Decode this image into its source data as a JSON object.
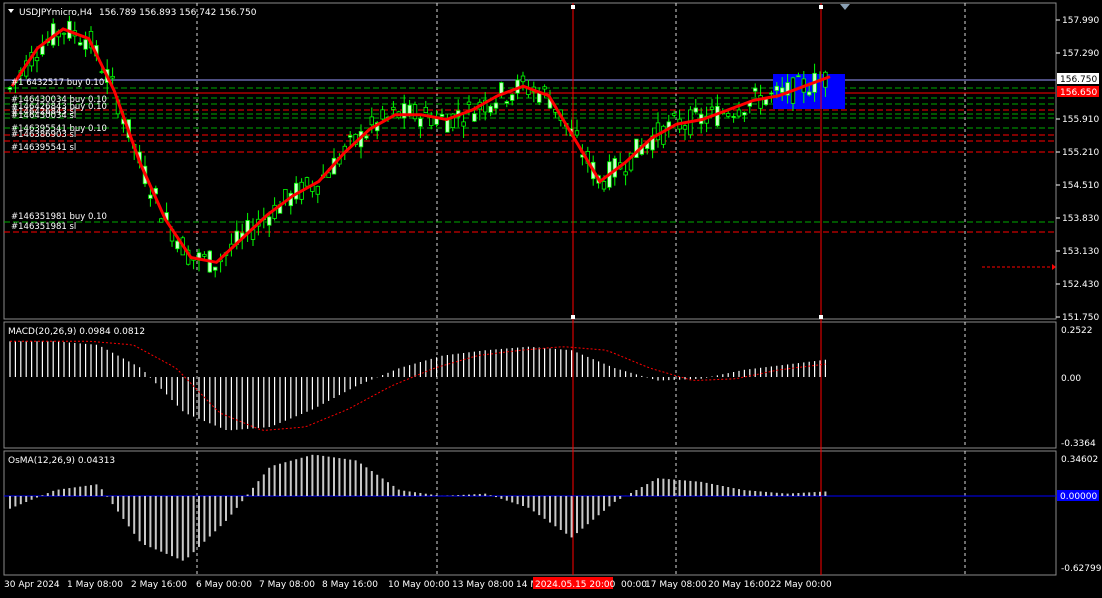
{
  "chart_header": {
    "symbol_timeframe": "USDJPYmicro,H4",
    "ohlc": "156.789 156.893 156.742 156.750"
  },
  "price_axis": {
    "ticks": [
      "157.990",
      "157.290",
      "156.750",
      "155.910",
      "155.210",
      "154.510",
      "153.830",
      "153.130",
      "152.430",
      "151.750"
    ],
    "current_price": "156.750",
    "current_price_box_color": "#ffffff",
    "red_price_box": "156.650"
  },
  "time_axis": {
    "labels": [
      "30 Apr 2024",
      "1 May 08:00",
      "2 May 16:00",
      "6 May 00:00",
      "7 May 08:00",
      "8 May 16:00",
      "10 May 00:00",
      "13 May 08:00",
      "14 M",
      "2024.05.15 20:00",
      "00:00",
      "17 May 08:00",
      "20 May 16:00",
      "22 May 00:00"
    ],
    "highlight_color": "#ff0000"
  },
  "order_labels": [
    "#1  6432517 buy 0.10",
    "#146430034 buy 0.10",
    "#146426843 buy 0.10",
    "#146426843 sl",
    "#146430034 sl",
    "#146395541 buy 0.10",
    "#146386903 sl",
    "#146395541 sl",
    "#146351981 buy 0.10",
    "#146351981 sl"
  ],
  "macd": {
    "label": "MACD(20,26,9) 0.0984 0.0812",
    "ticks": [
      "0.2522",
      "0.00",
      "-0.3364"
    ]
  },
  "osma": {
    "label": "OsMA(12,26,9) 0.04313",
    "ticks": [
      "0.34602",
      "-0.62799"
    ],
    "zero_box": "0.00000"
  },
  "colors": {
    "background": "#000000",
    "bull_candle": "#ccffcc",
    "bear_candle": "#000000",
    "wick": "#00ff00",
    "ma_line": "#ff0000",
    "buy_line": "#00aa00",
    "sl_line": "#ff0000",
    "grid": "#ffffff",
    "selection_box": "#0000ff",
    "signal_line": "#ff0000",
    "osma_zero": "#0000ff"
  },
  "chart_data": [
    {
      "type": "candlestick",
      "title": "USDJPYmicro,H4",
      "series": [
        {
          "name": "MA",
          "values": [
            156.6,
            157.4,
            157.8,
            157.6,
            156.5,
            155.0,
            153.8,
            153.0,
            152.9,
            153.4,
            153.9,
            154.3,
            154.6,
            155.2,
            155.7,
            156.0,
            156.0,
            155.9,
            156.1,
            156.4,
            156.6,
            156.4,
            155.5,
            154.6,
            155.0,
            155.5,
            155.8,
            155.9,
            156.1,
            156.3,
            156.4,
            156.6,
            156.8
          ]
        },
        {
          "name": "MACD",
          "values": [
            0.2,
            0.2,
            0.18,
            0.05,
            -0.2,
            -0.3,
            -0.28,
            -0.18,
            -0.05,
            0.05,
            0.12,
            0.15,
            0.17,
            0.15,
            0.05,
            -0.02,
            -0.01,
            0.04,
            0.07,
            0.1
          ]
        },
        {
          "name": "OsMA",
          "values": [
            -0.1,
            0.05,
            0.1,
            -0.4,
            -0.55,
            -0.2,
            0.25,
            0.35,
            0.3,
            0.05,
            0.0,
            0.02,
            -0.1,
            -0.35,
            -0.05,
            0.15,
            0.12,
            0.05,
            0.02,
            0.04
          ]
        }
      ],
      "ylim": [
        151.75,
        158.3
      ]
    }
  ]
}
